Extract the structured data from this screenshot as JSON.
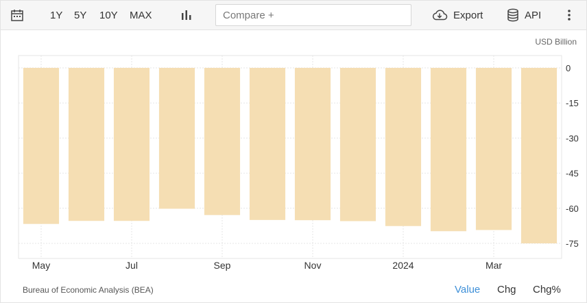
{
  "toolbar": {
    "icons": {
      "calendar": "calendar-icon",
      "chart_type": "bar-chart-icon",
      "export": "cloud-download-icon",
      "api": "database-icon",
      "more": "more-vertical-icon"
    },
    "ranges": [
      "1Y",
      "5Y",
      "10Y",
      "MAX"
    ],
    "compare_placeholder": "Compare +",
    "export_label": "Export",
    "api_label": "API"
  },
  "unit_label": "USD Billion",
  "source": "Bureau of Economic Analysis (BEA)",
  "view_tabs": {
    "value": "Value",
    "chg": "Chg",
    "chg_pct": "Chg%",
    "active": "Value",
    "active_color": "#3d8fd8"
  },
  "colors": {
    "bar": "#f5deb3",
    "grid": "#e6e6e6",
    "axis_text": "#333333"
  },
  "chart_data": {
    "type": "bar",
    "categories": [
      "2023-05",
      "2023-06",
      "2023-07",
      "2023-08",
      "2023-09",
      "2023-10",
      "2023-11",
      "2023-12",
      "2024-01",
      "2024-02",
      "2024-03",
      "2024-04"
    ],
    "values": [
      -66.7,
      -65.4,
      -65.4,
      -60.2,
      -62.9,
      -65.0,
      -65.1,
      -65.5,
      -67.6,
      -69.8,
      -69.3,
      -75.0
    ],
    "x_tick_labels": [
      "May",
      "Jul",
      "Sep",
      "Nov",
      "2024",
      "Mar"
    ],
    "x_tick_categories": [
      "2023-05",
      "2023-07",
      "2023-09",
      "2023-11",
      "2024-01",
      "2024-03"
    ],
    "y_ticks": [
      0,
      -15,
      -30,
      -45,
      -60,
      -75
    ],
    "ylim": [
      -75,
      0
    ],
    "y_axis_side": "right",
    "grid": true
  }
}
